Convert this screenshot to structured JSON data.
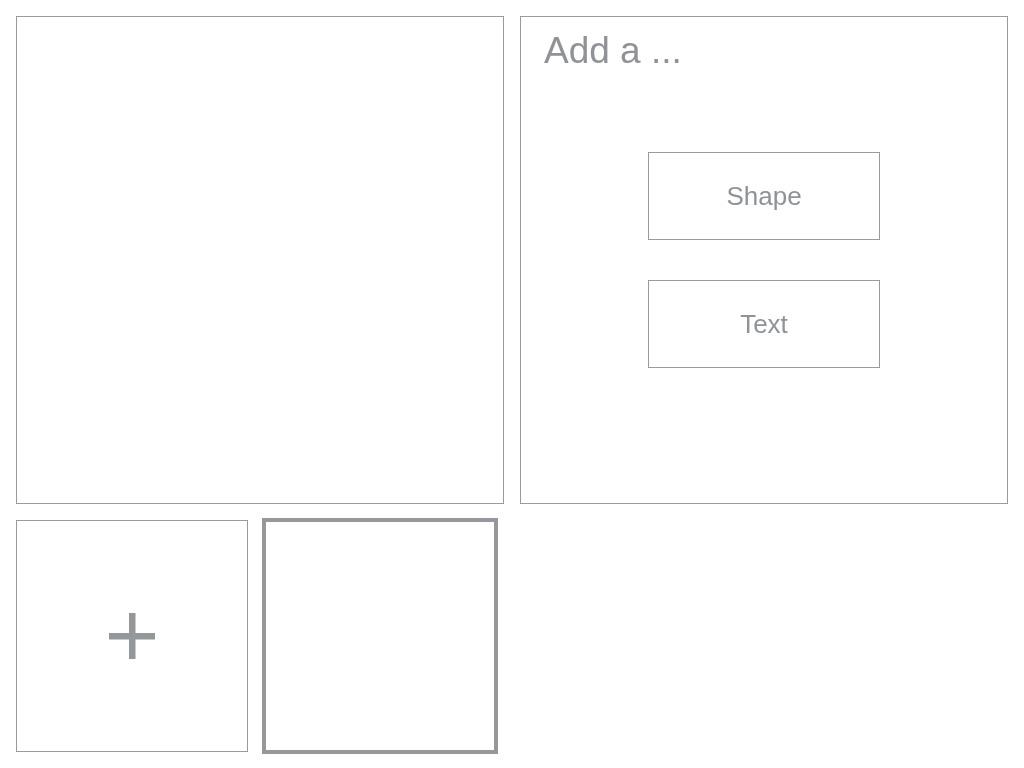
{
  "add_panel": {
    "title": "Add a ...",
    "options": [
      {
        "label": "Shape"
      },
      {
        "label": "Text"
      }
    ]
  },
  "tiles": [
    {
      "kind": "add",
      "selected": false
    },
    {
      "kind": "blank",
      "selected": true
    }
  ]
}
